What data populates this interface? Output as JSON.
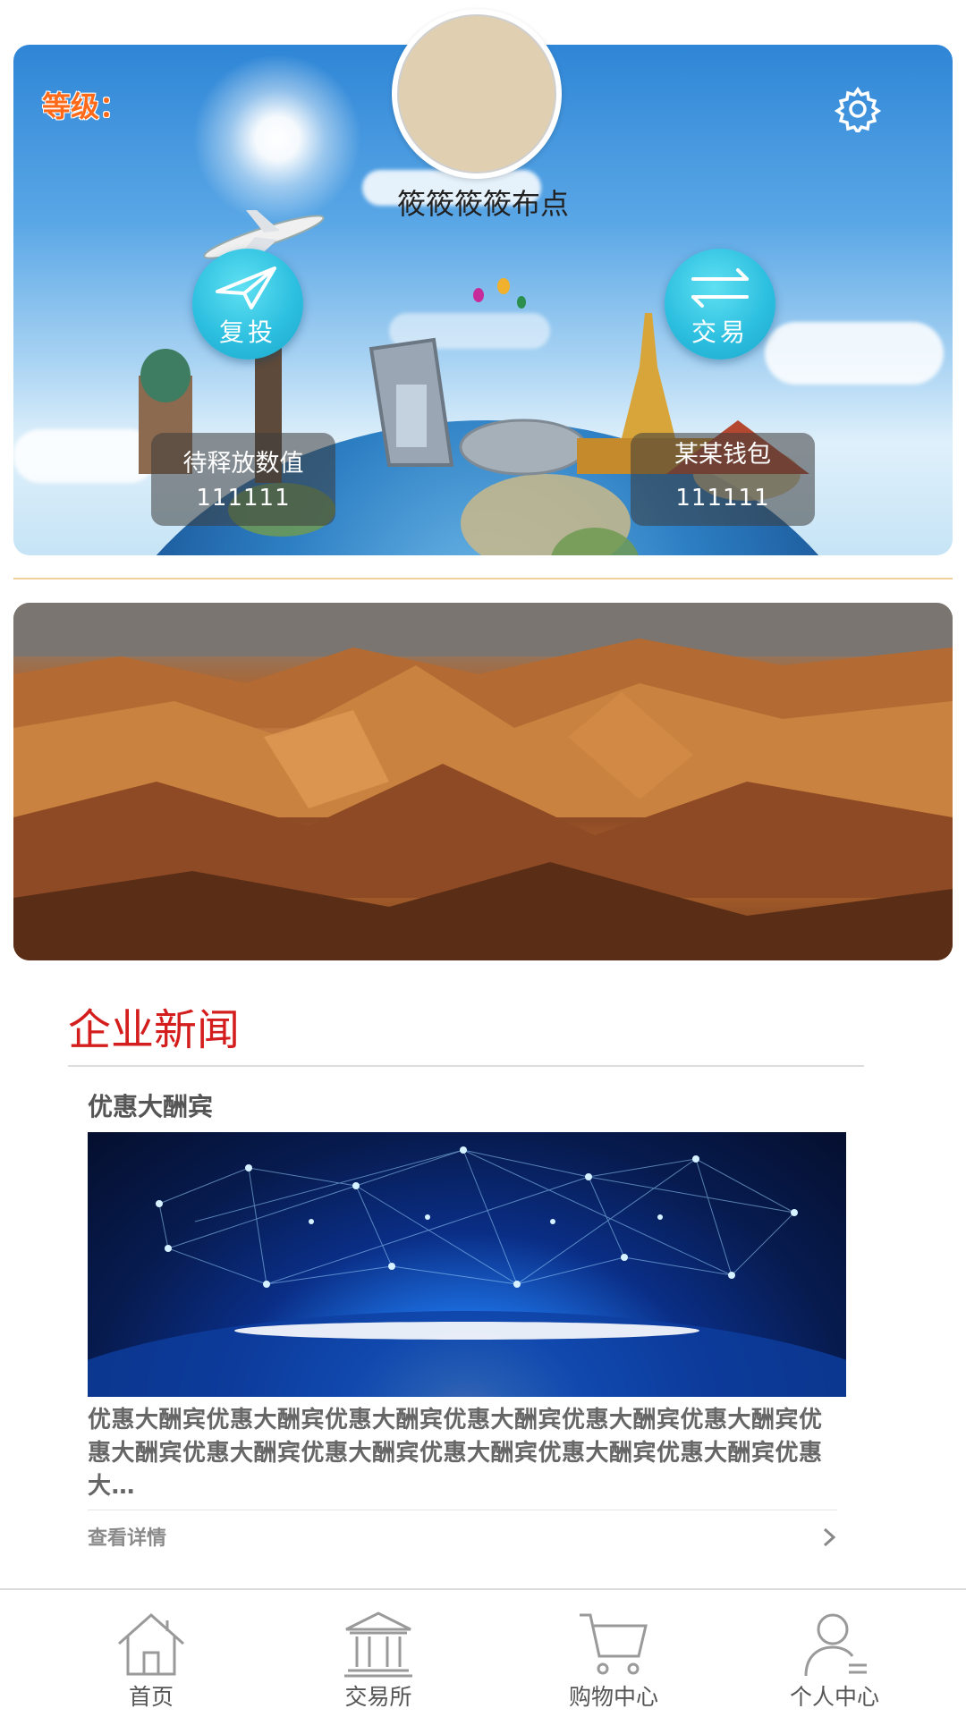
{
  "profile": {
    "level_label": "等级：",
    "username": "筱筱筱筱布点"
  },
  "actions": {
    "reinvest_label": "复投",
    "trade_label": "交易"
  },
  "stats": {
    "pending_release_label": "待释放数值",
    "pending_release_value": "111111",
    "wallet_label": "某某钱包",
    "wallet_value": "111111"
  },
  "news": {
    "section_title": "企业新闻",
    "item_title": "优惠大酬宾",
    "item_desc": "优惠大酬宾优惠大酬宾优惠大酬宾优惠大酬宾优惠大酬宾优惠大酬宾优惠大酬宾优惠大酬宾优惠大酬宾优惠大酬宾优惠大酬宾优惠大酬宾优惠大…",
    "detail_link": "查看详情"
  },
  "bottom_nav": {
    "items": [
      {
        "label": "首页",
        "icon": "home-icon"
      },
      {
        "label": "交易所",
        "icon": "exchange-building-icon"
      },
      {
        "label": "购物中心",
        "icon": "shopping-cart-icon"
      },
      {
        "label": "个人中心",
        "icon": "user-icon"
      }
    ]
  },
  "colors": {
    "accent_red": "#d41e1e",
    "level_orange": "#ff6a1a",
    "action_cyan": "#2ec0e0",
    "divider_orange": "#f2cf9a"
  }
}
